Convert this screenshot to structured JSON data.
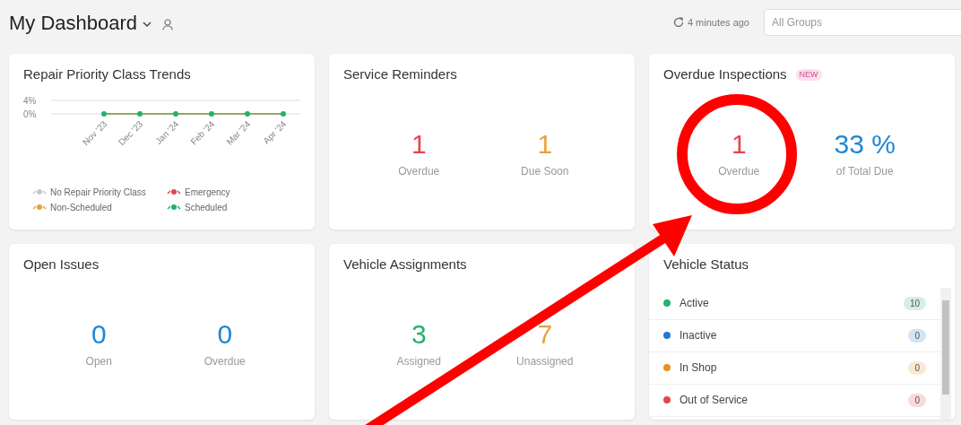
{
  "header": {
    "title": "My Dashboard",
    "refreshed": "4 minutes ago",
    "group_select": {
      "placeholder": "All Groups"
    }
  },
  "repair_trends": {
    "title": "Repair Priority Class Trends",
    "chart_data": {
      "type": "line",
      "categories": [
        "Nov '23",
        "Dec '23",
        "Jan '24",
        "Feb '24",
        "Mar '24",
        "Apr '24"
      ],
      "yticks": [
        {
          "value": 0,
          "label": "0%"
        },
        {
          "value": 4,
          "label": "4%"
        }
      ],
      "ylim": [
        0,
        4
      ],
      "series": [
        {
          "name": "No Repair Priority Class",
          "color": "#c8c8c8",
          "values": [
            null,
            null,
            null,
            null,
            null,
            null
          ]
        },
        {
          "name": "Emergency",
          "color": "#e2474b",
          "values": [
            null,
            null,
            null,
            null,
            null,
            null
          ]
        },
        {
          "name": "Non-Scheduled",
          "color": "#e6a23c",
          "values": [
            null,
            null,
            null,
            null,
            null,
            null
          ]
        },
        {
          "name": "Scheduled",
          "color": "#23b26d",
          "marker": true,
          "values": [
            0,
            0,
            0,
            0,
            0,
            0
          ]
        }
      ]
    }
  },
  "service_reminders": {
    "title": "Service Reminders",
    "stats": [
      {
        "value": "1",
        "label": "Overdue",
        "color": "#e2474b"
      },
      {
        "value": "1",
        "label": "Due Soon",
        "color": "#e6a23c"
      }
    ]
  },
  "overdue_inspections": {
    "title": "Overdue Inspections",
    "badge": "NEW",
    "stats": [
      {
        "value": "1",
        "label": "Overdue",
        "color": "#e2474b"
      },
      {
        "value": "33 %",
        "label": "of Total Due",
        "color": "#1f87d6"
      }
    ]
  },
  "open_issues": {
    "title": "Open Issues",
    "stats": [
      {
        "value": "0",
        "label": "Open",
        "color": "#1f87d6"
      },
      {
        "value": "0",
        "label": "Overdue",
        "color": "#1f87d6"
      }
    ]
  },
  "vehicle_assignments": {
    "title": "Vehicle Assignments",
    "stats": [
      {
        "value": "3",
        "label": "Assigned",
        "color": "#23b26d"
      },
      {
        "value": "7",
        "label": "Unassigned",
        "color": "#e6a23c"
      }
    ]
  },
  "vehicle_status": {
    "title": "Vehicle Status",
    "items": [
      {
        "label": "Active",
        "count": "10",
        "color": "#23b26d"
      },
      {
        "label": "Inactive",
        "count": "0",
        "color": "#1f7bd6"
      },
      {
        "label": "In Shop",
        "count": "0",
        "color": "#e8911e"
      },
      {
        "label": "Out of Service",
        "count": "0",
        "color": "#e2474b"
      }
    ]
  }
}
